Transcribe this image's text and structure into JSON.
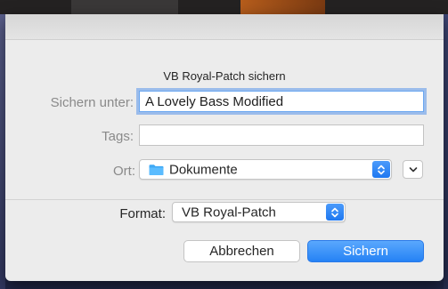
{
  "dialog": {
    "title": "VB Royal-Patch sichern",
    "save_as_label": "Sichern unter:",
    "save_as_value": "A Lovely Bass Modified",
    "tags_label": "Tags:",
    "tags_value": "",
    "location_label": "Ort:",
    "location_value": "Dokumente",
    "format_label": "Format:",
    "format_value": "VB Royal-Patch",
    "cancel_label": "Abbrechen",
    "save_label": "Sichern"
  },
  "colors": {
    "accent": "#2582f5",
    "sheet_bg": "#ececec",
    "folder": "#3fa9f5"
  },
  "icons": {
    "location_folder": "folder-icon",
    "location_stepper": "up-down-chevron-icon",
    "expand": "chevron-down-icon",
    "format_stepper": "up-down-chevron-icon"
  }
}
